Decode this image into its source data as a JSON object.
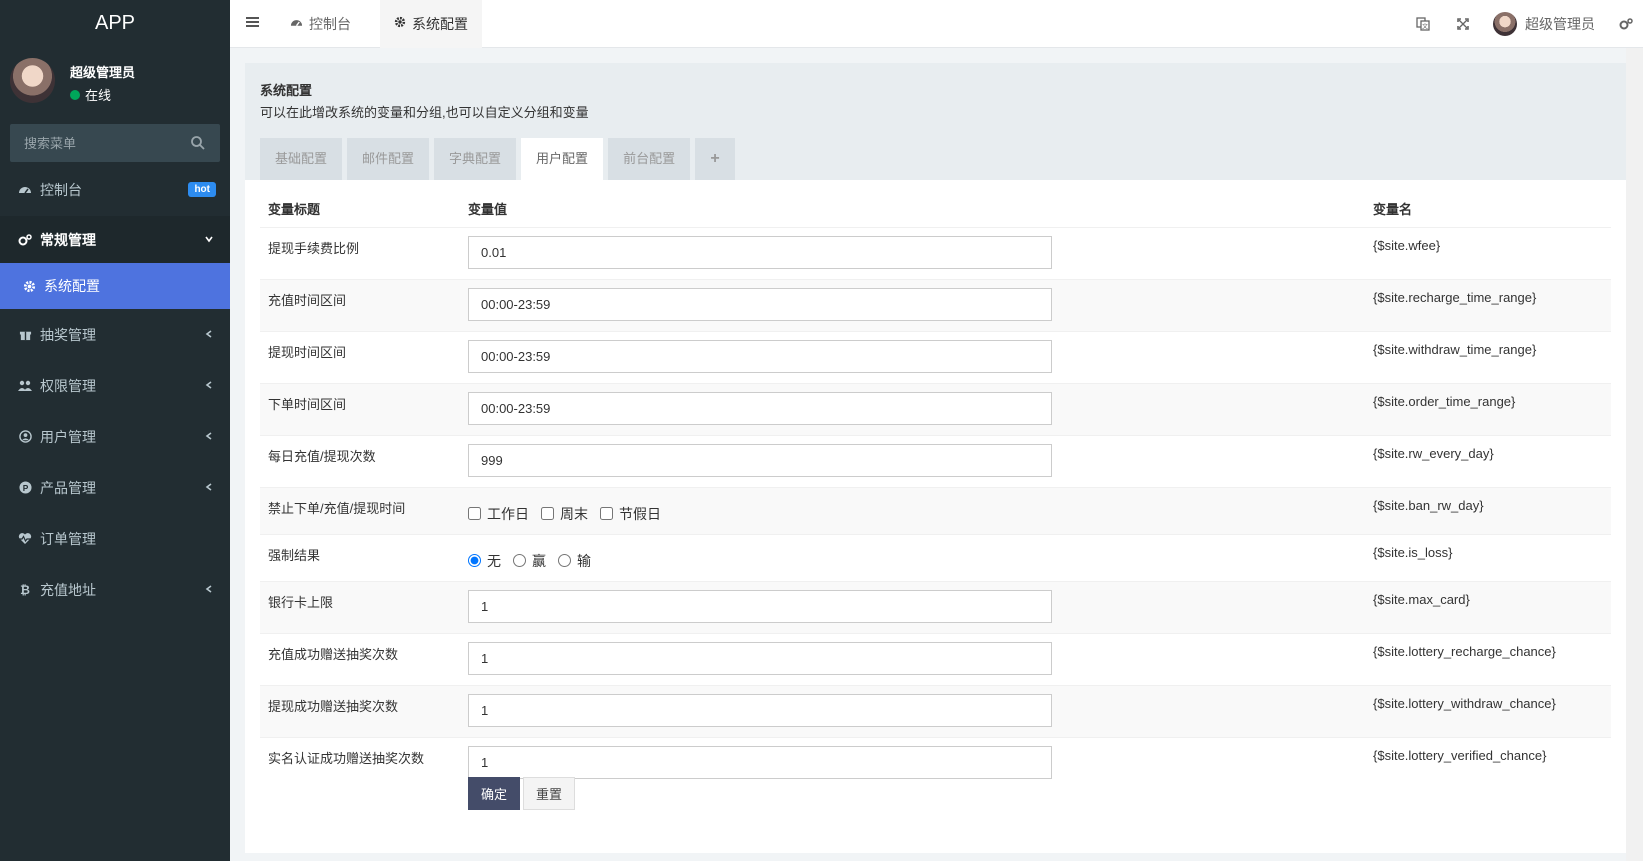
{
  "app": {
    "brand": "APP"
  },
  "user": {
    "name": "超级管理员",
    "status": "在线"
  },
  "search": {
    "placeholder": "搜索菜单"
  },
  "sidebar": {
    "items": [
      {
        "label": "控制台",
        "icon": "dashboard-icon",
        "badge": "hot"
      },
      {
        "label": "常规管理",
        "icon": "cogs-icon",
        "state": "open"
      },
      {
        "label": "系统配置",
        "icon": "gear-icon",
        "state": "active"
      },
      {
        "label": "抽奖管理",
        "icon": "gift-icon"
      },
      {
        "label": "权限管理",
        "icon": "group-icon"
      },
      {
        "label": "用户管理",
        "icon": "user-circle-icon"
      },
      {
        "label": "产品管理",
        "icon": "product-p-icon"
      },
      {
        "label": "订单管理",
        "icon": "heartbeat-icon"
      },
      {
        "label": "充值地址",
        "icon": "bitcoin-icon"
      }
    ]
  },
  "topbar": {
    "tabs": [
      {
        "label": "控制台",
        "icon": "dashboard-icon"
      },
      {
        "label": "系统配置",
        "icon": "gear-icon"
      }
    ],
    "user_name": "超级管理员"
  },
  "panel": {
    "title": "系统配置",
    "desc": "可以在此增改系统的变量和分组,也可以自定义分组和变量",
    "tabs": [
      "基础配置",
      "邮件配置",
      "字典配置",
      "用户配置",
      "前台配置"
    ],
    "active_tab": "用户配置",
    "plus": "+"
  },
  "table": {
    "headers": [
      "变量标题",
      "变量值",
      "变量名"
    ],
    "rows": [
      {
        "title": "提现手续费比例",
        "type": "input",
        "value": "0.01",
        "name": "{$site.wfee}"
      },
      {
        "title": "充值时间区间",
        "type": "input",
        "value": "00:00-23:59",
        "name": "{$site.recharge_time_range}"
      },
      {
        "title": "提现时间区间",
        "type": "input",
        "value": "00:00-23:59",
        "name": "{$site.withdraw_time_range}"
      },
      {
        "title": "下单时间区间",
        "type": "input",
        "value": "00:00-23:59",
        "name": "{$site.order_time_range}"
      },
      {
        "title": "每日充值/提现次数",
        "type": "input",
        "value": "999",
        "name": "{$site.rw_every_day}"
      },
      {
        "title": "禁止下单/充值/提现时间",
        "type": "checkbox",
        "options": [
          "工作日",
          "周末",
          "节假日"
        ],
        "name": "{$site.ban_rw_day}"
      },
      {
        "title": "强制结果",
        "type": "radio",
        "options": [
          "无",
          "赢",
          "输"
        ],
        "selected": "无",
        "name": "{$site.is_loss}"
      },
      {
        "title": "银行卡上限",
        "type": "input",
        "value": "1",
        "name": "{$site.max_card}"
      },
      {
        "title": "充值成功赠送抽奖次数",
        "type": "input",
        "value": "1",
        "name": "{$site.lottery_recharge_chance}"
      },
      {
        "title": "提现成功赠送抽奖次数",
        "type": "input",
        "value": "1",
        "name": "{$site.lottery_withdraw_chance}"
      },
      {
        "title": "实名认证成功赠送抽奖次数",
        "type": "input",
        "value": "1",
        "name": "{$site.lottery_verified_chance}"
      }
    ]
  },
  "buttons": {
    "submit": "确定",
    "reset": "重置"
  },
  "colors": {
    "sidebar_bg": "#222d32",
    "active_menu": "#4e73df",
    "primary_button": "#444c69",
    "online": "#00a65a"
  }
}
